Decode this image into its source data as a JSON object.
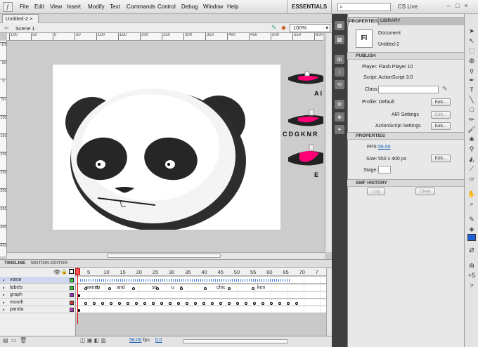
{
  "menu": [
    "File",
    "Edit",
    "View",
    "Insert",
    "Modify",
    "Text",
    "Commands",
    "Control",
    "Debug",
    "Window",
    "Help"
  ],
  "workspace": "ESSENTIALS",
  "search_placeholder": "",
  "cslive": "CS Live",
  "document_tab": "Untitled-2",
  "scene": "Scene 1",
  "zoom": "100%",
  "ruler_h": [
    "100",
    "50",
    "0",
    "50",
    "100",
    "150",
    "200",
    "250",
    "300",
    "350",
    "400",
    "450",
    "500",
    "550",
    "600"
  ],
  "ruler_v": [
    "-100",
    "-50",
    "0",
    "50",
    "100",
    "150",
    "200",
    "250",
    "300",
    "350",
    "400",
    "450"
  ],
  "stage_side_labels": [
    "AI",
    "CDGKNR",
    "E"
  ],
  "timeline": {
    "tabs": [
      "TIMELINE",
      "MOTION EDITOR"
    ],
    "frame_numbers": [
      "5",
      "10",
      "15",
      "20",
      "25",
      "30",
      "35",
      "40",
      "45",
      "50",
      "55",
      "60",
      "65",
      "70",
      "7"
    ],
    "layers": [
      {
        "name": "voice",
        "color": "#33cc33"
      },
      {
        "name": "labels",
        "color": "#33cc33"
      },
      {
        "name": "graph",
        "color": "#9933cc"
      },
      {
        "name": "mouth",
        "color": "#cc3333"
      },
      {
        "name": "panda",
        "color": "#cc33cc"
      }
    ],
    "frame_labels": [
      "sweep",
      "it",
      "and",
      "so",
      "u",
      "y",
      "chic",
      "ken"
    ],
    "fps": "56.00",
    "fps_unit": "fps",
    "time": "0.0"
  },
  "properties": {
    "tabs": [
      "PROPERTIES",
      "LIBRARY"
    ],
    "doc_type": "Document",
    "doc_name": "Untitled-2",
    "icon_text": "Fl",
    "publish_header": "PUBLISH",
    "player": "Player: Flash Player 10",
    "script": "Script: ActionScript 3.0",
    "class_label": "Class:",
    "profile": "Profile: Default",
    "edit": "Edit...",
    "air_settings": "AIR Settings",
    "as_settings": "ActionScript Settings",
    "props_header": "PROPERTIES",
    "fps_label": "FPS:",
    "fps_value": "56.00",
    "size_label": "Size:",
    "size_value": "550 x 400 px",
    "stage_label": "Stage:",
    "stage_color": "#ffffff",
    "swf_header": "SWF HISTORY",
    "log": "Log",
    "clear": "Clear"
  }
}
